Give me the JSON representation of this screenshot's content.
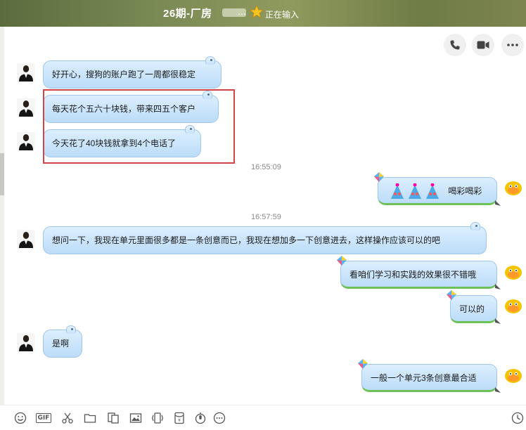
{
  "window": {
    "title": "26期-厂房",
    "title_dots": "...",
    "typing_status": "正在输入"
  },
  "messages": {
    "m1": "好开心，搜狗的账户跑了一周都很稳定",
    "m2": "每天花个五六十块钱，带来四五个客户",
    "m3": "今天花了40块钱就拿到4个电话了",
    "t1": "16:55:09",
    "r1": "喝彩喝彩",
    "t2": "16:57:59",
    "m4": "想问一下，我现在单元里面很多都是一条创意而已，我现在想加多一下创意进去，这样操作应该可以的吧",
    "r2": "看咱们学习和实践的效果很不错哦",
    "r3": "可以的",
    "m5": "是啊",
    "r4": "一般一个单元3条创意最合适"
  },
  "toolbar": {
    "gif_label": "GIF"
  },
  "colors": {
    "bubble_border": "#9ec6ea",
    "highlight": "#d34545",
    "self_underline": "#6cc158"
  }
}
